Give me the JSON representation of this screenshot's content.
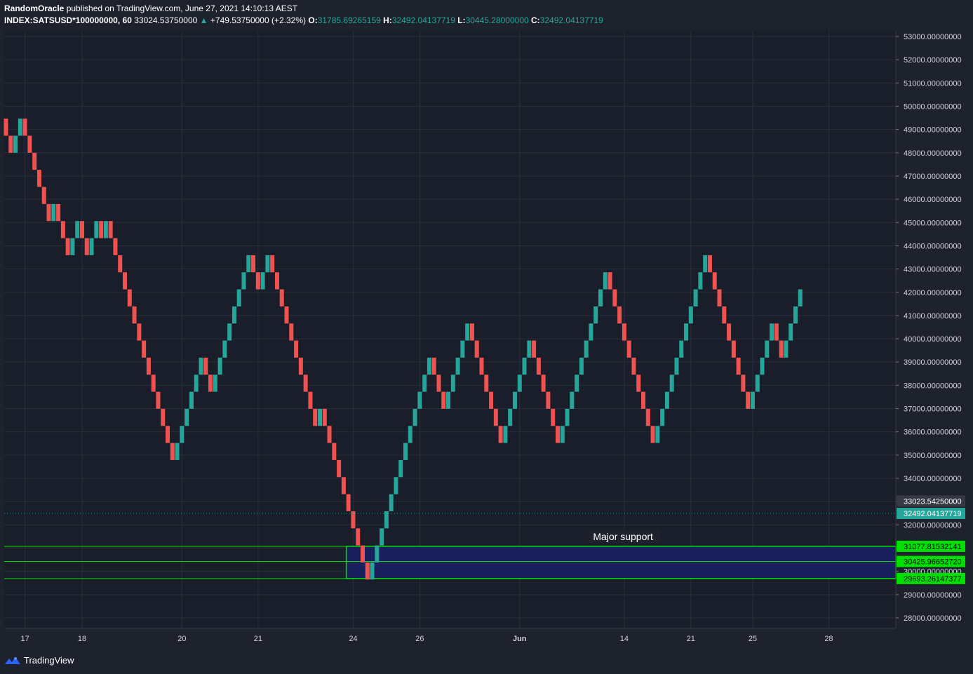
{
  "header": {
    "author": "RandomOracle",
    "published": "published on TradingView.com, June 27, 2021 14:10:13 AEST",
    "symbol": "INDEX:SATSUSD*100000000, 60",
    "last": "33024.53750000",
    "change_arrow": "▲",
    "change": "+749.53750000 (+2.32%)",
    "o_label": "O:",
    "o": "31785.69265159",
    "h_label": "H:",
    "h": "32492.04137719",
    "l_label": "L:",
    "l": "30445.28000000",
    "c_label": "C:",
    "c": "32492.04137719"
  },
  "footer": {
    "brand": "TradingView",
    "logo_icon": "tradingview-logo-icon"
  },
  "colors": {
    "background": "#1e222d",
    "grid": "#2a2e39",
    "up": "#26a69a",
    "down": "#ef5350",
    "support_fill": "#1a1f5e",
    "support_line": "#00e000",
    "label_dark": "#363a45",
    "label_price": "#26a69a"
  },
  "chart_data": {
    "type": "renko",
    "ylim": [
      27600,
      53400
    ],
    "y_ticks": [
      "28000.00000000",
      "29000.00000000",
      "30000.00000000",
      "31000.00000000",
      "32000.00000000",
      "33000.00000000",
      "34000.00000000",
      "35000.00000000",
      "36000.00000000",
      "37000.00000000",
      "38000.00000000",
      "39000.00000000",
      "40000.00000000",
      "41000.00000000",
      "42000.00000000",
      "43000.00000000",
      "44000.00000000",
      "45000.00000000",
      "46000.00000000",
      "47000.00000000",
      "48000.00000000",
      "49000.00000000",
      "50000.00000000",
      "51000.00000000",
      "52000.00000000",
      "53000.00000000"
    ],
    "x_labels": [
      {
        "label": "17",
        "index": 4
      },
      {
        "label": "18",
        "index": 16
      },
      {
        "label": "20",
        "index": 37
      },
      {
        "label": "21",
        "index": 53
      },
      {
        "label": "24",
        "index": 73
      },
      {
        "label": "26",
        "index": 87
      },
      {
        "label": "Jun",
        "index": 108
      },
      {
        "label": "14",
        "index": 130
      },
      {
        "label": "21",
        "index": 144
      },
      {
        "label": "25",
        "index": 157
      },
      {
        "label": "28",
        "index": 173
      }
    ],
    "first_low": 48733,
    "box_size": 734,
    "directions": "DDUUDDDDDDUDDDUUDDUUDUDDDDDDDDDDDDDDUUUUUUDDUUUUUUUUDDUUDDDDDDDDDDUDDDDDDDDDDUUUUUUUUUUUUUDDDUUUUUDDDDDDDUUUUUUDDDDDDUUUUUUUUUUDDDDDDDDDDUUUUUUUUUUUDDDDDDDDDUUUUUDDUUUU",
    "price_labels": [
      {
        "value": 33023.5425,
        "text": "33023.54250000",
        "kind": "last"
      },
      {
        "value": 32492.04137719,
        "text": "32492.04137719",
        "kind": "price"
      },
      {
        "value": 31077.81532141,
        "text": "31077.81532141",
        "kind": "support"
      },
      {
        "value": 30425.9665272,
        "text": "30425.96652720",
        "kind": "support"
      },
      {
        "value": 29693.26147377,
        "text": "29693.26147377",
        "kind": "support"
      }
    ],
    "support_zone": {
      "top": 31077.81532141,
      "mid": 30425.9665272,
      "bottom": 29693.26147377,
      "label": "Major support",
      "start_index": 72
    },
    "current_price": 32492.04137719
  }
}
